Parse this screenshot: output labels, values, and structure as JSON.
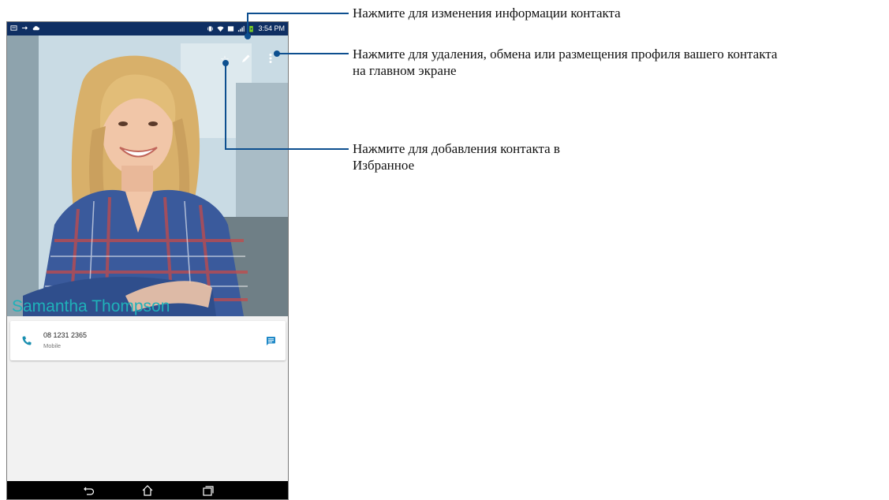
{
  "statusbar": {
    "time": "3:54 PM"
  },
  "contact": {
    "name": "Samantha Thompson",
    "phone_number": "08 1231 2365",
    "phone_type": "Mobile"
  },
  "callouts": {
    "edit": "Нажмите для изменения информации контакта",
    "menu_line1": "Нажмите для удаления, обмена или размещения профиля вашего контакта",
    "menu_line2": "на главном экране",
    "favorite_line1": "Нажмите для добавления контакта в",
    "favorite_line2": "Избранное"
  },
  "colors": {
    "accent": "#1fb1b9",
    "statusbar": "#0f2f63",
    "callout_line": "#0d4f8f"
  }
}
